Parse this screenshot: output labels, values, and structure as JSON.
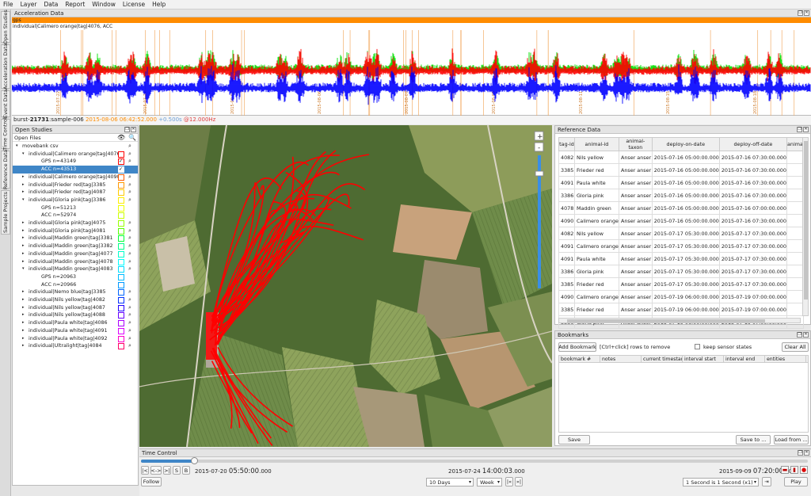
{
  "menu": [
    "File",
    "Layer",
    "Data",
    "Report",
    "Window",
    "License",
    "Help"
  ],
  "side_tabs": [
    "Open Studies",
    "Acceleration Data",
    "Event Data",
    "Time Control",
    "Reference Data",
    "Sample Projects"
  ],
  "accel": {
    "title": "Acceleration Data",
    "gps_label": "gps",
    "track_label": "individual|Calimero orange|tag|4076, ACC",
    "date_marks": [
      "2015-07-22",
      "2015-07-24",
      "2015-08-01",
      "2015-08-06",
      "2015-08-07",
      "2015-08-09",
      "2015-08-11",
      "2015-08-15",
      "2015-08-18"
    ]
  },
  "burst": {
    "prefix": "burst-",
    "id": "21731",
    "sample": ":sample-006 ",
    "time": "2015-08-06 06:42:52.000",
    "offset": " +0.500s",
    "freq": " @12.000Hz"
  },
  "studies": {
    "title": "Open Studies",
    "open_files": "Open Files",
    "rows": [
      {
        "label": "movebank csv",
        "indent": 0,
        "arrow": "▾",
        "mag": true
      },
      {
        "label": "individual|Calimero orange|tag|4076",
        "indent": 1,
        "arrow": "▾",
        "swatch": "#ff0000",
        "mag": true
      },
      {
        "label": "GPS n=43149",
        "indent": 3,
        "check": true,
        "swatch": "#ff0000",
        "mag": true
      },
      {
        "label": "ACC n=43513",
        "indent": 3,
        "check": true,
        "sel": true
      },
      {
        "label": "individual|Calimero orange|tag|4090",
        "indent": 1,
        "arrow": "▸",
        "swatch": "#ff5a00",
        "mag": true
      },
      {
        "label": "individual|Frieder red|tag|3385",
        "indent": 1,
        "arrow": "▸",
        "swatch": "#ff9900",
        "mag": true
      },
      {
        "label": "individual|Frieder red|tag|4087",
        "indent": 1,
        "arrow": "▸",
        "swatch": "#ffcc00",
        "mag": true
      },
      {
        "label": "individual|Gloria pink|tag|3386",
        "indent": 1,
        "arrow": "▾",
        "swatch": "#ffee00",
        "mag": true
      },
      {
        "label": "GPS n=51213",
        "indent": 3,
        "swatch": "#eeff00"
      },
      {
        "label": "ACC n=52974",
        "indent": 3,
        "swatch": "#ccff00"
      },
      {
        "label": "individual|Gloria pink|tag|4075",
        "indent": 1,
        "arrow": "▸",
        "swatch": "#99ff00",
        "mag": true
      },
      {
        "label": "individual|Gloria pink|tag|4081",
        "indent": 1,
        "arrow": "▸",
        "swatch": "#55ff00",
        "mag": true
      },
      {
        "label": "individual|Maddin green|tag|3381",
        "indent": 1,
        "arrow": "▸",
        "swatch": "#00ff33",
        "mag": true
      },
      {
        "label": "individual|Maddin green|tag|3382",
        "indent": 1,
        "arrow": "▸",
        "swatch": "#00ff88",
        "mag": true
      },
      {
        "label": "individual|Maddin green|tag|4077",
        "indent": 1,
        "arrow": "▸",
        "swatch": "#00ffcc",
        "mag": true
      },
      {
        "label": "individual|Maddin green|tag|4078",
        "indent": 1,
        "arrow": "▸",
        "swatch": "#00ffff",
        "mag": true
      },
      {
        "label": "individual|Maddin green|tag|4083",
        "indent": 1,
        "arrow": "▾",
        "swatch": "#00ddff",
        "mag": true
      },
      {
        "label": "GPS n=20963",
        "indent": 3,
        "swatch": "#00bbff"
      },
      {
        "label": "ACC n=20966",
        "indent": 3,
        "swatch": "#0099ff"
      },
      {
        "label": "individual|Nemo blue|tag|3385",
        "indent": 1,
        "arrow": "▸",
        "swatch": "#0066ff",
        "mag": true
      },
      {
        "label": "individual|Nils yellow|tag|4082",
        "indent": 1,
        "arrow": "▸",
        "swatch": "#0033ff",
        "mag": true
      },
      {
        "label": "individual|Nils yellow|tag|4087",
        "indent": 1,
        "arrow": "▸",
        "swatch": "#2200ff",
        "mag": true
      },
      {
        "label": "individual|Nils yellow|tag|4088",
        "indent": 1,
        "arrow": "▸",
        "swatch": "#6600ff",
        "mag": true
      },
      {
        "label": "individual|Paula white|tag|4086",
        "indent": 1,
        "arrow": "▸",
        "swatch": "#aa00ff",
        "mag": true
      },
      {
        "label": "individual|Paula white|tag|4091",
        "indent": 1,
        "arrow": "▸",
        "swatch": "#dd00ff",
        "mag": true
      },
      {
        "label": "individual|Paula white|tag|4092",
        "indent": 1,
        "arrow": "▸",
        "swatch": "#ff00cc",
        "mag": true
      },
      {
        "label": "individual|Ultralight|tag|4084",
        "indent": 1,
        "arrow": "▸",
        "swatch": "#ff0066",
        "mag": true
      }
    ]
  },
  "reference": {
    "title": "Reference Data",
    "columns": [
      "tag-id",
      "animal-id",
      "animal-taxon",
      "deploy-on-date",
      "deploy-off-date",
      "anima"
    ],
    "rows": [
      [
        "4082",
        "Nils yellow",
        "Anser anser",
        "2015-07-16 05:00:00.000",
        "2015-07-16 07:30:00.000"
      ],
      [
        "3385",
        "Frieder red",
        "Anser anser",
        "2015-07-16 05:00:00.000",
        "2015-07-16 07:30:00.000"
      ],
      [
        "4091",
        "Paula white",
        "Anser anser",
        "2015-07-16 05:00:00.000",
        "2015-07-16 07:30:00.000"
      ],
      [
        "3386",
        "Gloria pink",
        "Anser anser",
        "2015-07-16 05:00:00.000",
        "2015-07-16 07:30:00.000"
      ],
      [
        "4078",
        "Maddin green",
        "Anser anser",
        "2015-07-16 05:00:00.000",
        "2015-07-16 07:00:00.000"
      ],
      [
        "4090",
        "Calimero orange",
        "Anser anser",
        "2015-07-16 05:00:00.000",
        "2015-07-16 07:30:00.000"
      ],
      [
        "4082",
        "Nils yellow",
        "Anser anser",
        "2015-07-17 05:30:00.000",
        "2015-07-17 07:30:00.000"
      ],
      [
        "4091",
        "Calimero orange",
        "Anser anser",
        "2015-07-17 05:30:00.000",
        "2015-07-17 07:30:00.000"
      ],
      [
        "4091",
        "Paula white",
        "Anser anser",
        "2015-07-17 05:30:00.000",
        "2015-07-17 07:30:00.000"
      ],
      [
        "3386",
        "Gloria pink",
        "Anser anser",
        "2015-07-17 05:30:00.000",
        "2015-07-17 07:30:00.000"
      ],
      [
        "3385",
        "Frieder red",
        "Anser anser",
        "2015-07-17 05:30:00.000",
        "2015-07-17 07:30:00.000"
      ],
      [
        "4090",
        "Calimero orange",
        "Anser anser",
        "2015-07-19 06:00:00.000",
        "2015-07-19 07:00:00.000"
      ],
      [
        "3385",
        "Frieder red",
        "Anser anser",
        "2015-07-19 06:00:00.000",
        "2015-07-19 07:00:00.000"
      ],
      [
        "3386",
        "Gloria pink",
        "Anser anser",
        "2015-07-19 06:00:00.000",
        "2015-07-19 07:00:00.000"
      ]
    ]
  },
  "bookmarks": {
    "title": "Bookmarks",
    "add_label": "Add Bookmark",
    "hint": "[Ctrl+click] rows to remove",
    "keep_label": "keep sensor states",
    "clear_label": "Clear All",
    "columns": [
      "bookmark #",
      "notes",
      "current timestamp",
      "interval start",
      "interval end",
      "entities"
    ],
    "save_label": "Save",
    "save_to_label": "Save to ...",
    "load_label": "Load from ..."
  },
  "timecontrol": {
    "title": "Time Control",
    "start_date": "2015-07-20 ",
    "start_time": "05:50:00",
    "start_ms": ".000",
    "current_date": "2015-07-24 ",
    "current_time": "14:00:03",
    "current_ms": ".000",
    "end_date": "2015-09-09 ",
    "end_time": "07:20:00",
    "end_ms": ".000",
    "nav_buttons": [
      "|<",
      "<->",
      ">|",
      "S",
      "B"
    ],
    "follow_label": "Follow",
    "range_select": "10 Days",
    "step_select": "Week",
    "speed_select": "1 Second is 1 Second (x1)",
    "play_label": "Play",
    "slider_position": 0.08
  },
  "colors": {
    "selection": "#3f86c7",
    "track": "#ff0000",
    "gps_bar": "#ff8c00",
    "accel_x": "#ff0000",
    "accel_y": "#00e000",
    "accel_z": "#0000ff"
  }
}
